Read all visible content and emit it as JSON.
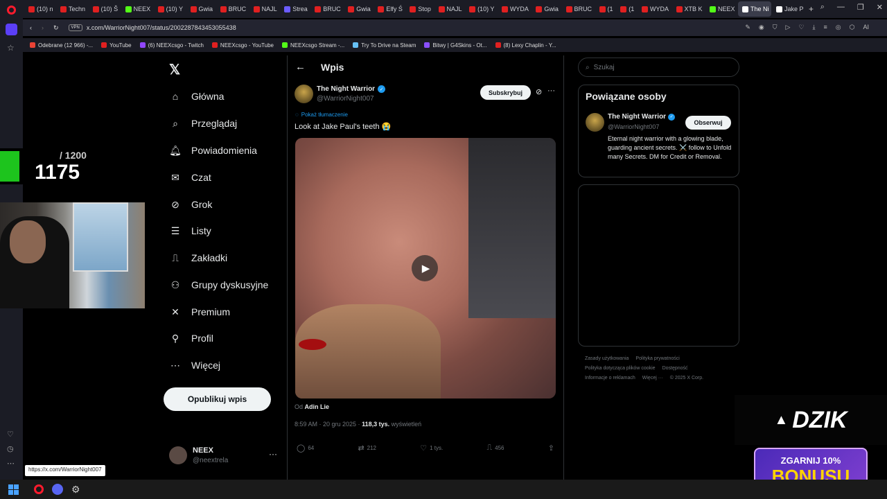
{
  "tabs": [
    {
      "label": "(10) n",
      "color": "#e02020"
    },
    {
      "label": "Techn",
      "color": "#e02020"
    },
    {
      "label": "(10) Š",
      "color": "#e02020"
    },
    {
      "label": "NEEX",
      "color": "#53fc18"
    },
    {
      "label": "(10) Y",
      "color": "#e02020"
    },
    {
      "label": "Gwia",
      "color": "#e02020"
    },
    {
      "label": "BRUC",
      "color": "#e02020"
    },
    {
      "label": "NAJL",
      "color": "#e02020"
    },
    {
      "label": "Strea",
      "color": "#6b5cff"
    },
    {
      "label": "BRUC",
      "color": "#e02020"
    },
    {
      "label": "Gwia",
      "color": "#e02020"
    },
    {
      "label": "Elfy Ś",
      "color": "#e02020"
    },
    {
      "label": "Stop",
      "color": "#e02020"
    },
    {
      "label": "NAJL",
      "color": "#e02020"
    },
    {
      "label": "(10) Y",
      "color": "#e02020"
    },
    {
      "label": "WYDA",
      "color": "#e02020"
    },
    {
      "label": "Gwia",
      "color": "#e02020"
    },
    {
      "label": "BRUC",
      "color": "#e02020"
    },
    {
      "label": "(1",
      "color": "#e02020"
    },
    {
      "label": "(1",
      "color": "#e02020"
    },
    {
      "label": "WYDA",
      "color": "#e02020"
    },
    {
      "label": "XTB K",
      "color": "#e02020"
    },
    {
      "label": "NEEX",
      "color": "#53fc18"
    },
    {
      "label": "The Ni",
      "color": "#ffffff",
      "active": true
    },
    {
      "label": "Jake P",
      "color": "#ffffff"
    }
  ],
  "address": {
    "url": "x.com/WarriorNight007/status/2002287843453055438",
    "vpn": "VPN"
  },
  "bookmarks": [
    {
      "label": "Odebrane (12 966) -...",
      "color": "#ea4335"
    },
    {
      "label": "YouTube",
      "color": "#e02020"
    },
    {
      "label": "(6) NEEXcsgo - Twitch",
      "color": "#9146ff"
    },
    {
      "label": "NEEXcsgo - YouTube",
      "color": "#e02020"
    },
    {
      "label": "NEEXcsgo Stream -...",
      "color": "#53fc18"
    },
    {
      "label": "Try To Drive na Steam",
      "color": "#66c0f4"
    },
    {
      "label": "Bitwy | G4Skins - Ot...",
      "color": "#8a4fff"
    },
    {
      "label": "(8) Lexy Chaplin - Y...",
      "color": "#e02020"
    }
  ],
  "nav": [
    {
      "label": "Główna",
      "icon": "home-icon"
    },
    {
      "label": "Przeglądaj",
      "icon": "search-icon"
    },
    {
      "label": "Powiadomienia",
      "icon": "bell-icon"
    },
    {
      "label": "Czat",
      "icon": "mail-icon"
    },
    {
      "label": "Grok",
      "icon": "grok-icon"
    },
    {
      "label": "Listy",
      "icon": "list-icon"
    },
    {
      "label": "Zakładki",
      "icon": "bookmark-icon"
    },
    {
      "label": "Grupy dyskusyjne",
      "icon": "people-icon"
    },
    {
      "label": "Premium",
      "icon": "x-icon"
    },
    {
      "label": "Profil",
      "icon": "person-icon"
    },
    {
      "label": "Więcej",
      "icon": "more-icon"
    }
  ],
  "post_button": "Opublikuj wpis",
  "account": {
    "name": "NEEX",
    "handle": "@neextrela"
  },
  "header": {
    "title": "Wpis"
  },
  "post": {
    "author": "The Night Warrior",
    "handle": "@WarriorNight007",
    "subscribe": "Subskrybuj",
    "translate": "Pokaż tłumaczenie",
    "text": "Look at Jake Paul's teeth 😭",
    "from_prefix": "Od",
    "from_name": "Adin Lie",
    "time": "8:59 AM · 20 gru 2025 · ",
    "views_count": "118,3 tys.",
    "views_label": " wyświetleń",
    "replies": "64",
    "reposts": "212",
    "likes": "1 tys.",
    "bookmarks": "456"
  },
  "sidebar": {
    "search_placeholder": "Szukaj",
    "related_title": "Powiązane osoby",
    "related": {
      "name": "The Night Warrior",
      "handle": "@WarriorNight007",
      "follow": "Obserwuj",
      "bio": "Eternal night warrior with a glowing blade, guarding ancient secrets. ⚔️ follow to Unfold many Secrets. DM for Credit or Removal."
    },
    "footer": [
      "Zasady użytkowania",
      "Polityka prywatności",
      "Polityka dotycząca plików cookie",
      "Dostępność",
      "Informacje o reklamach",
      "Więcej ···",
      "© 2025 X Corp."
    ]
  },
  "overlay": {
    "counter_total": "/ 1200",
    "counter_value": "1175",
    "dzik": "DZIK",
    "bonus_line1": "ZGARNIJ 10%",
    "bonus_line2": "BONUSU"
  },
  "tooltip": "https://x.com/WarriorNight007"
}
